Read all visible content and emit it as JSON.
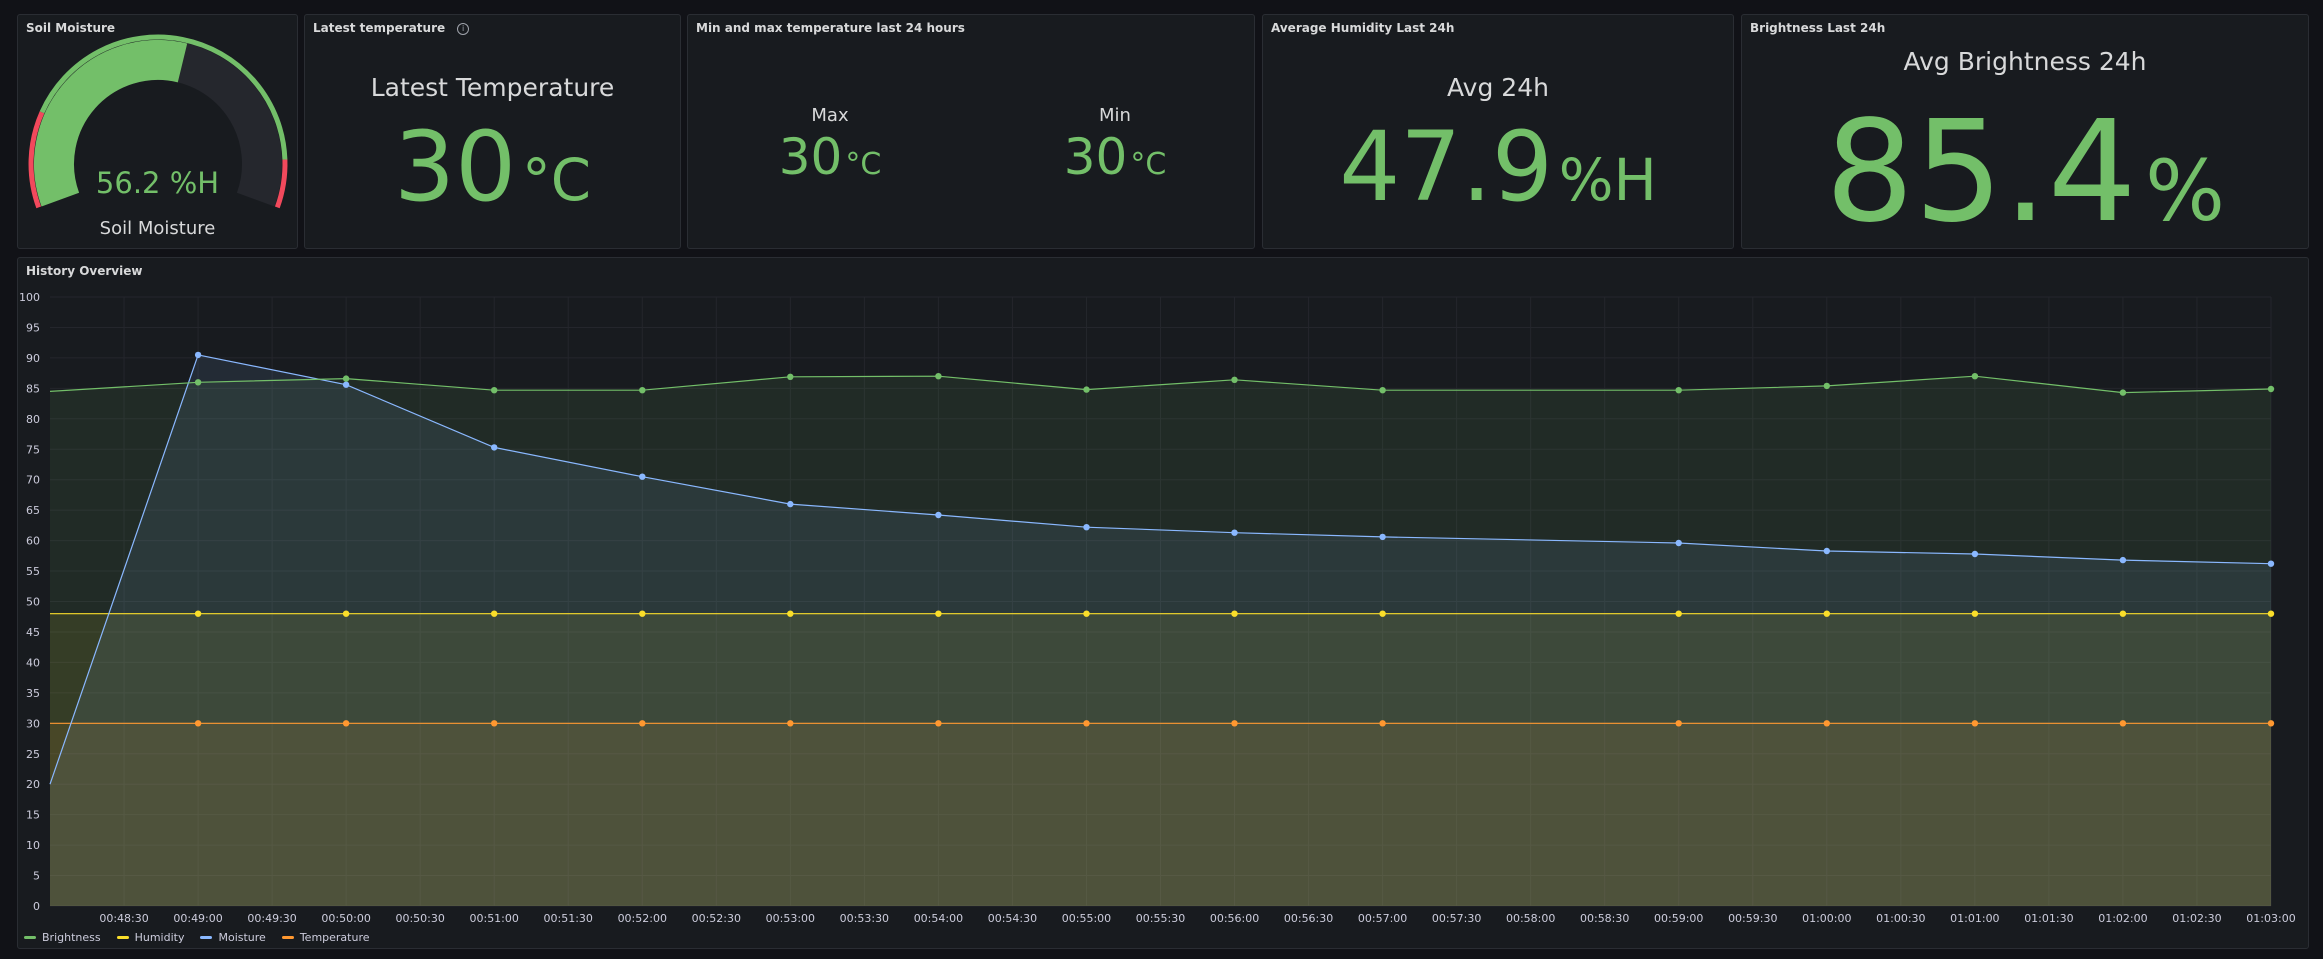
{
  "panels": {
    "soil": {
      "title": "Soil Moisture",
      "value": "56.2 %H",
      "label": "Soil Moisture",
      "gauge_fraction": 0.562
    },
    "latest_temp": {
      "title": "Latest temperature",
      "label": "Latest Temperature",
      "value": "30",
      "unit": "°C"
    },
    "minmax": {
      "title": "Min and max temperature last 24 hours",
      "max_label": "Max",
      "max_value": "30",
      "max_unit": "°C",
      "min_label": "Min",
      "min_value": "30",
      "min_unit": "°C"
    },
    "humidity": {
      "title": "Average Humidity Last 24h",
      "label": "Avg 24h",
      "value": "47.9",
      "unit": "%H"
    },
    "brightness": {
      "title": "Brightness Last 24h",
      "label": "Avg Brightness 24h",
      "value": "85.4",
      "unit": "%"
    },
    "history": {
      "title": "History Overview"
    }
  },
  "colors": {
    "green": "#73bf69",
    "yellow": "#fade2a",
    "blue": "#8ab8ff",
    "orange": "#ff9830",
    "red": "#f2495c"
  },
  "chart_data": {
    "type": "line",
    "title": "History Overview",
    "x": [
      "00:48:00",
      "00:49:00",
      "00:50:00",
      "00:51:00",
      "00:52:00",
      "00:53:00",
      "00:54:00",
      "00:55:00",
      "00:56:00",
      "00:57:00",
      "00:59:00",
      "01:00:00",
      "01:01:00",
      "01:02:00",
      "01:03:00"
    ],
    "x_ticks": [
      "00:48:30",
      "00:49:00",
      "00:49:30",
      "00:50:00",
      "00:50:30",
      "00:51:00",
      "00:51:30",
      "00:52:00",
      "00:52:30",
      "00:53:00",
      "00:53:30",
      "00:54:00",
      "00:54:30",
      "00:55:00",
      "00:55:30",
      "00:56:00",
      "00:56:30",
      "00:57:00",
      "00:57:30",
      "00:58:00",
      "00:58:30",
      "00:59:00",
      "00:59:30",
      "01:00:00",
      "01:00:30",
      "01:01:00",
      "01:01:30",
      "01:02:00",
      "01:02:30",
      "01:03:00"
    ],
    "y_ticks": [
      0,
      5,
      10,
      15,
      20,
      25,
      30,
      35,
      40,
      45,
      50,
      55,
      60,
      65,
      70,
      75,
      80,
      85,
      90,
      95,
      100
    ],
    "ylim": [
      0,
      100
    ],
    "grid": true,
    "legend_position": "bottom-left",
    "series": [
      {
        "name": "Brightness",
        "color": "#73bf69",
        "values": [
          84.5,
          86,
          86.6,
          84.7,
          84.7,
          86.9,
          87,
          84.8,
          86.4,
          84.7,
          84.7,
          85.4,
          87,
          84.3,
          84.9
        ]
      },
      {
        "name": "Humidity",
        "color": "#fade2a",
        "values": [
          48,
          48,
          48,
          48,
          48,
          48,
          48,
          48,
          48,
          48,
          48,
          48,
          48,
          48,
          48
        ]
      },
      {
        "name": "Moisture",
        "color": "#8ab8ff",
        "values": [
          20,
          90.5,
          85.6,
          75.3,
          70.5,
          66,
          64.2,
          62.2,
          61.3,
          60.6,
          59.6,
          58.3,
          57.8,
          56.8,
          56.2
        ]
      },
      {
        "name": "Temperature",
        "color": "#ff9830",
        "values": [
          30,
          30,
          30,
          30,
          30,
          30,
          30,
          30,
          30,
          30,
          30,
          30,
          30,
          30,
          30
        ]
      }
    ]
  }
}
